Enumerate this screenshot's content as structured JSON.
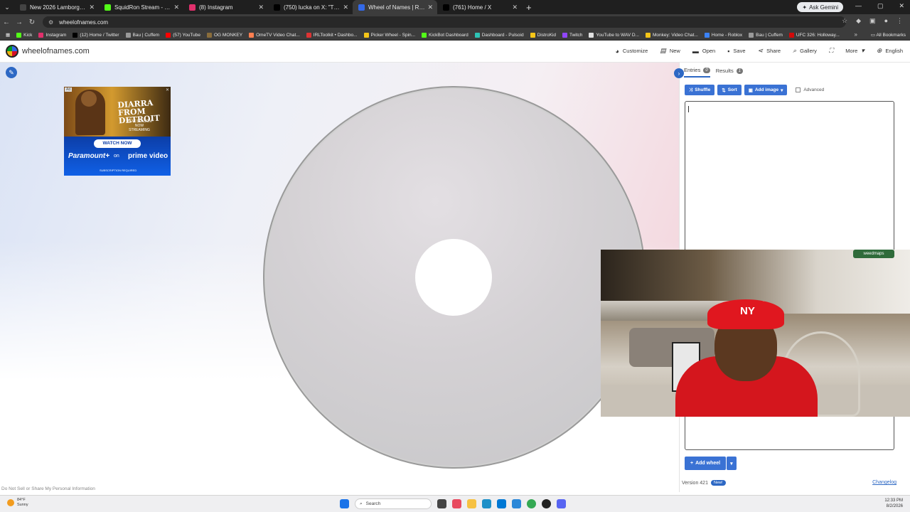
{
  "browser": {
    "tabs": [
      {
        "title": "New 2026 Lamborghini Urus SE",
        "color": "#444444"
      },
      {
        "title": "SquidRon Stream - Watch Live",
        "color": "#53fc18"
      },
      {
        "title": "(8) Instagram",
        "color": "#e1306c"
      },
      {
        "title": "(750) lucka on X: \"The ONLY th",
        "color": "#000000"
      },
      {
        "title": "Wheel of Names | Random nam",
        "color": "#3369e8"
      },
      {
        "title": "(761) Home / X",
        "color": "#000000"
      }
    ],
    "gemini_label": "Ask Gemini",
    "url": "wheelofnames.com",
    "bookmarks": [
      {
        "label": "Kick",
        "color": "#53fc18"
      },
      {
        "label": "Instagram",
        "color": "#e1306c"
      },
      {
        "label": "(12) Home / Twitter",
        "color": "#000000"
      },
      {
        "label": "Bau | Cuffem",
        "color": "#999999"
      },
      {
        "label": "(57) YouTube",
        "color": "#ff0000"
      },
      {
        "label": "OG MONKEY",
        "color": "#8a6d3b"
      },
      {
        "label": "OmeTV Video Chat...",
        "color": "#ff7f50"
      },
      {
        "label": "IRLToolkit • Dashbo...",
        "color": "#d33"
      },
      {
        "label": "Picker Wheel - Spin...",
        "color": "#f5c518"
      },
      {
        "label": "KickBot Dashboard",
        "color": "#53fc18"
      },
      {
        "label": "Dashboard - Pulsoid",
        "color": "#2ec4b6"
      },
      {
        "label": "DistroKid",
        "color": "#f5c518"
      },
      {
        "label": "Twitch",
        "color": "#9146ff"
      },
      {
        "label": "YouTube to WAV D...",
        "color": "#e0e0e0"
      },
      {
        "label": "Monkey: Video Chat...",
        "color": "#f5c518"
      },
      {
        "label": "Home - Roblox",
        "color": "#3b82f6"
      },
      {
        "label": "Bau | Cuffem",
        "color": "#999999"
      },
      {
        "label": "UFC 326: Holloway...",
        "color": "#d20a0a"
      }
    ],
    "all_bookmarks": "All Bookmarks"
  },
  "site": {
    "name": "wheelofnames.com",
    "menu": [
      {
        "label": "Customize",
        "icon": "palette-icon"
      },
      {
        "label": "New",
        "icon": "new-file-icon"
      },
      {
        "label": "Open",
        "icon": "folder-icon"
      },
      {
        "label": "Save",
        "icon": "save-icon"
      },
      {
        "label": "Share",
        "icon": "share-icon"
      },
      {
        "label": "Gallery",
        "icon": "search-icon"
      },
      {
        "label": "",
        "icon": "fullscreen-icon"
      },
      {
        "label": "More",
        "icon": "chevron-down-icon"
      },
      {
        "label": "English",
        "icon": "globe-icon"
      }
    ],
    "footer_note": "Do Not Sell or Share My Personal Information"
  },
  "ad": {
    "badge": "Ad",
    "headline": "DIARRA FROM DETROIT",
    "sub": "NEW SEASON NOW STREAMING",
    "cta": "WATCH NOW",
    "brand": "Paramount+",
    "on": "on",
    "partner": "prime video",
    "fine": "SUBSCRIPTION REQUIRED"
  },
  "panel": {
    "tab_entries": "Entries",
    "entries_count": "0",
    "tab_results": "Results",
    "results_count": "1",
    "shuffle": "Shuffle",
    "sort": "Sort",
    "add_image": "Add image",
    "advanced": "Advanced",
    "add_wheel": "Add wheel",
    "version": "Version 421",
    "new_badge": "New!",
    "changelog": "Changelog"
  },
  "webcam": {
    "watermark": "weedmaps",
    "cap_logo": "NY"
  },
  "taskbar": {
    "temp": "84°F",
    "condition": "Sunny",
    "search": "Search",
    "time": "12:33 PM",
    "date": "8/2/2026"
  }
}
